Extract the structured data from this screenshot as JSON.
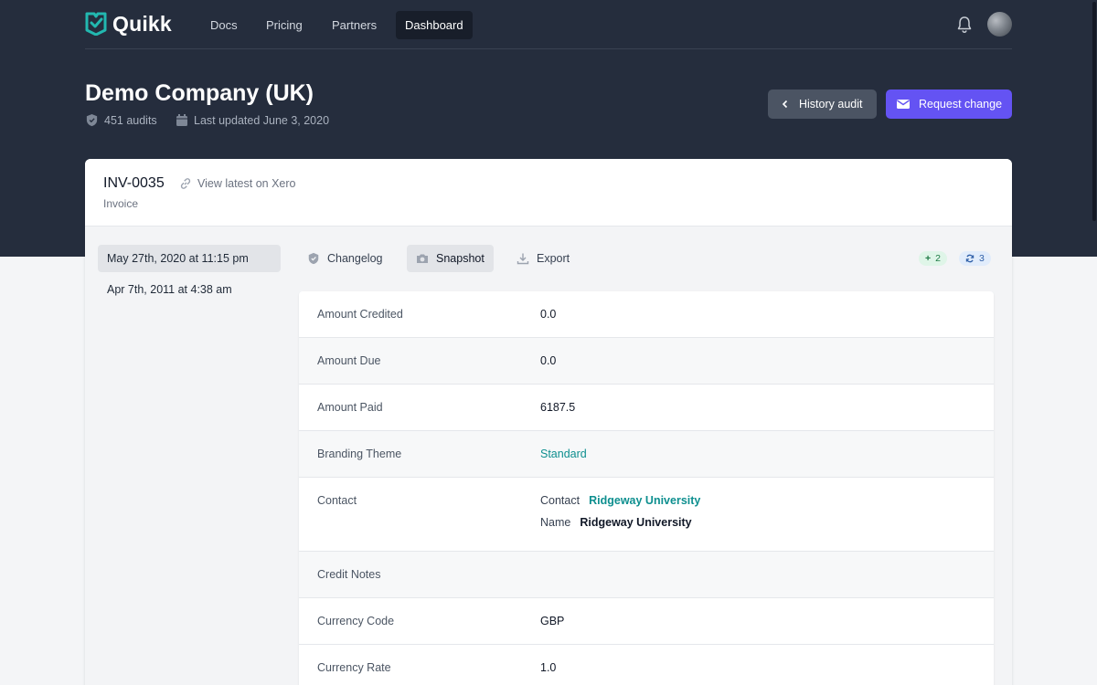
{
  "brand": {
    "name": "Quikk",
    "accent": "#22b8b0"
  },
  "nav": {
    "links": [
      "Docs",
      "Pricing",
      "Partners",
      "Dashboard"
    ],
    "active": "Dashboard"
  },
  "header": {
    "title": "Demo Company (UK)",
    "audits": "451 audits",
    "last_updated": "Last updated June 3, 2020",
    "history_button": "History audit",
    "request_button": "Request change"
  },
  "invoice": {
    "number": "INV-0035",
    "xero_link": "View latest on Xero",
    "type": "Invoice"
  },
  "dates": [
    "May 27th, 2020 at 11:15 pm",
    "Apr 7th, 2011 at 4:38 am"
  ],
  "tabs": [
    "Changelog",
    "Snapshot",
    "Export"
  ],
  "active_tab": "Snapshot",
  "badges": {
    "added": "2",
    "updated": "3"
  },
  "fields": [
    {
      "label": "Amount Credited",
      "value": "0.0"
    },
    {
      "label": "Amount Due",
      "value": "0.0"
    },
    {
      "label": "Amount Paid",
      "value": "6187.5"
    },
    {
      "label": "Branding Theme",
      "value": "Standard"
    },
    {
      "label": "Contact",
      "contact_label": "Contact",
      "contact_value": "Ridgeway University",
      "name_label": "Name",
      "name_value": "Ridgeway University"
    },
    {
      "label": "Credit Notes",
      "value": ""
    },
    {
      "label": "Currency Code",
      "value": "GBP"
    },
    {
      "label": "Currency Rate",
      "value": "1.0"
    }
  ],
  "colors": {
    "hero": "#252d3d",
    "primary": "#6453f3",
    "link": "#0e8f8f"
  }
}
